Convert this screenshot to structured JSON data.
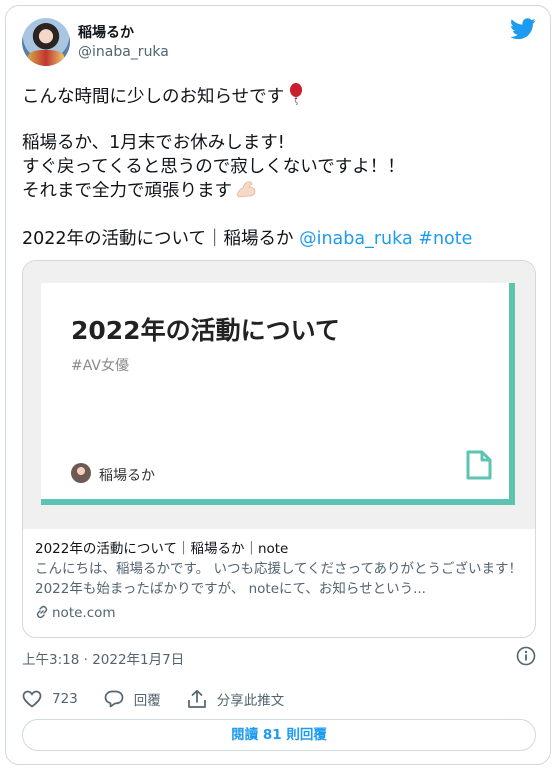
{
  "author": {
    "display_name": "稲場るか",
    "handle": "@inaba_ruka"
  },
  "tweet": {
    "line1": "こんな時間に少しのお知らせです",
    "line2": "稲場るか、1月末でお休みします!",
    "line3": "すぐ戻ってくると思うので寂しくないですよ！！",
    "line4": "それまで全力で頑張ります",
    "line5_text": "2022年の活動について｜稲場るか",
    "mention": "@inaba_ruka",
    "hashtag": "#note"
  },
  "link_card": {
    "image_title": "2022年の活動について",
    "image_tag": "#AV女優",
    "image_author": "稲場るか",
    "headline": "2022年の活動について｜稲場るか｜note",
    "description": "こんにちは、稲場るかです。 いつも応援してくださってありがとうございます！ 2022年も始まったばかりですが、 noteにて、お知らせという...",
    "domain": "note.com"
  },
  "timestamp": "上午3:18 · 2022年1月7日",
  "actions": {
    "likes": "723",
    "reply_label": "回覆",
    "share_label": "分享此推文"
  },
  "read_replies": "閱讀 81 則回覆",
  "colors": {
    "accent": "#1d9bf0",
    "note_green": "#5ec4b2",
    "muted": "#536471"
  }
}
